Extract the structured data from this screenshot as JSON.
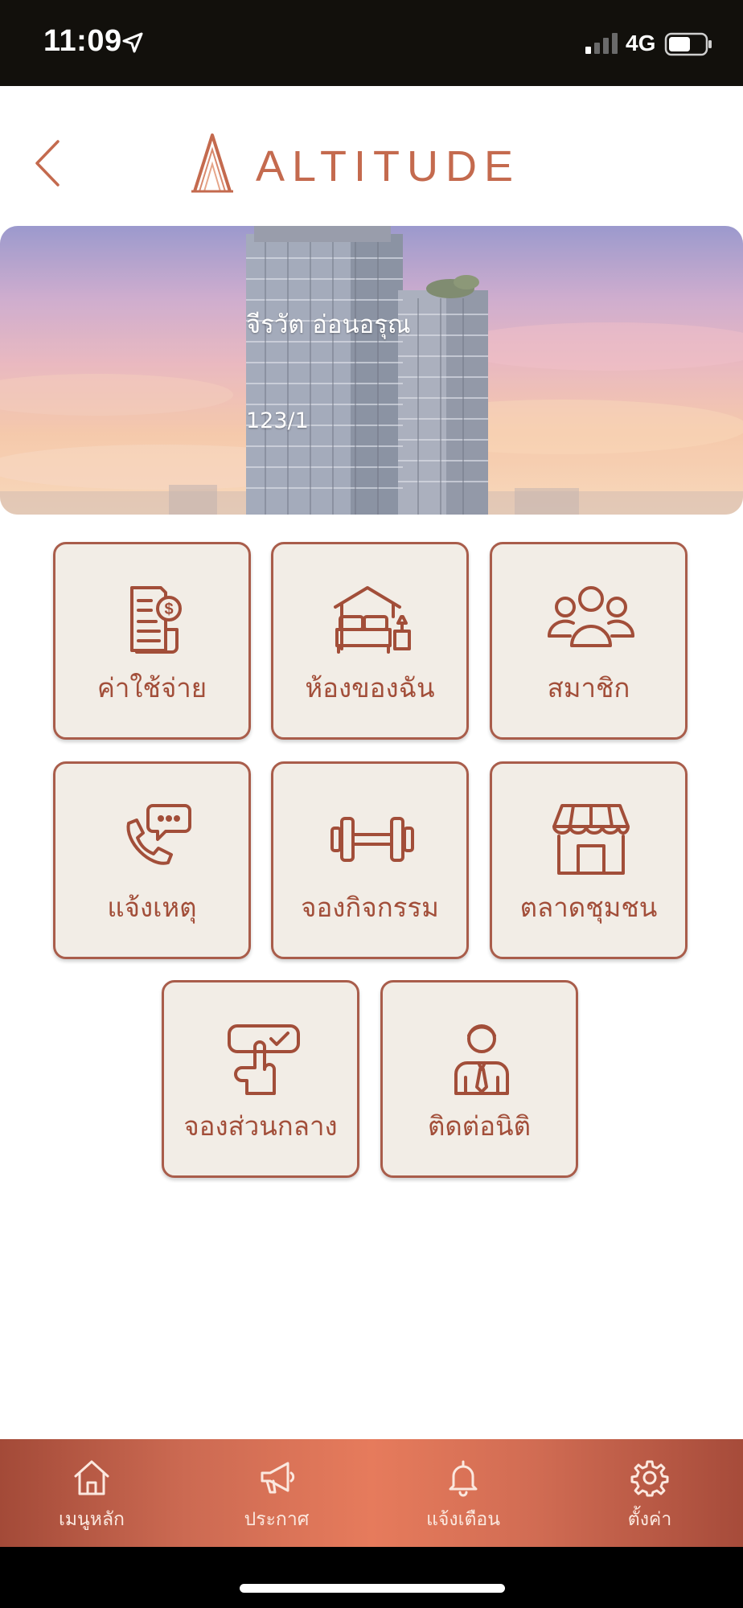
{
  "status_bar": {
    "time": "11:09",
    "network": "4G"
  },
  "header": {
    "logo_text": "ALTITUDE"
  },
  "banner": {
    "resident_name": "จีรวัต อ่อนอรุณ",
    "unit_number": "123/1"
  },
  "menu": {
    "items": [
      {
        "label": "ค่าใช้จ่าย",
        "icon": "bill-icon"
      },
      {
        "label": "ห้องของฉัน",
        "icon": "bedroom-icon"
      },
      {
        "label": "สมาชิก",
        "icon": "members-icon"
      },
      {
        "label": "แจ้งเหตุ",
        "icon": "phone-chat-icon"
      },
      {
        "label": "จองกิจกรรม",
        "icon": "dumbbell-icon"
      },
      {
        "label": "ตลาดชุมชน",
        "icon": "storefront-icon"
      },
      {
        "label": "จองส่วนกลาง",
        "icon": "hand-check-icon"
      },
      {
        "label": "ติดต่อนิติ",
        "icon": "staff-icon"
      }
    ]
  },
  "bottom_nav": {
    "items": [
      {
        "label": "เมนูหลัก",
        "icon": "home-icon"
      },
      {
        "label": "ประกาศ",
        "icon": "megaphone-icon"
      },
      {
        "label": "แจ้งเตือน",
        "icon": "bell-icon"
      },
      {
        "label": "ตั้งค่า",
        "icon": "gear-icon"
      }
    ]
  },
  "colors": {
    "accent": "#c46a4e",
    "tile_bg": "#f2ede6",
    "tile_border": "#a95d4b",
    "tile_text": "#a24e39"
  }
}
